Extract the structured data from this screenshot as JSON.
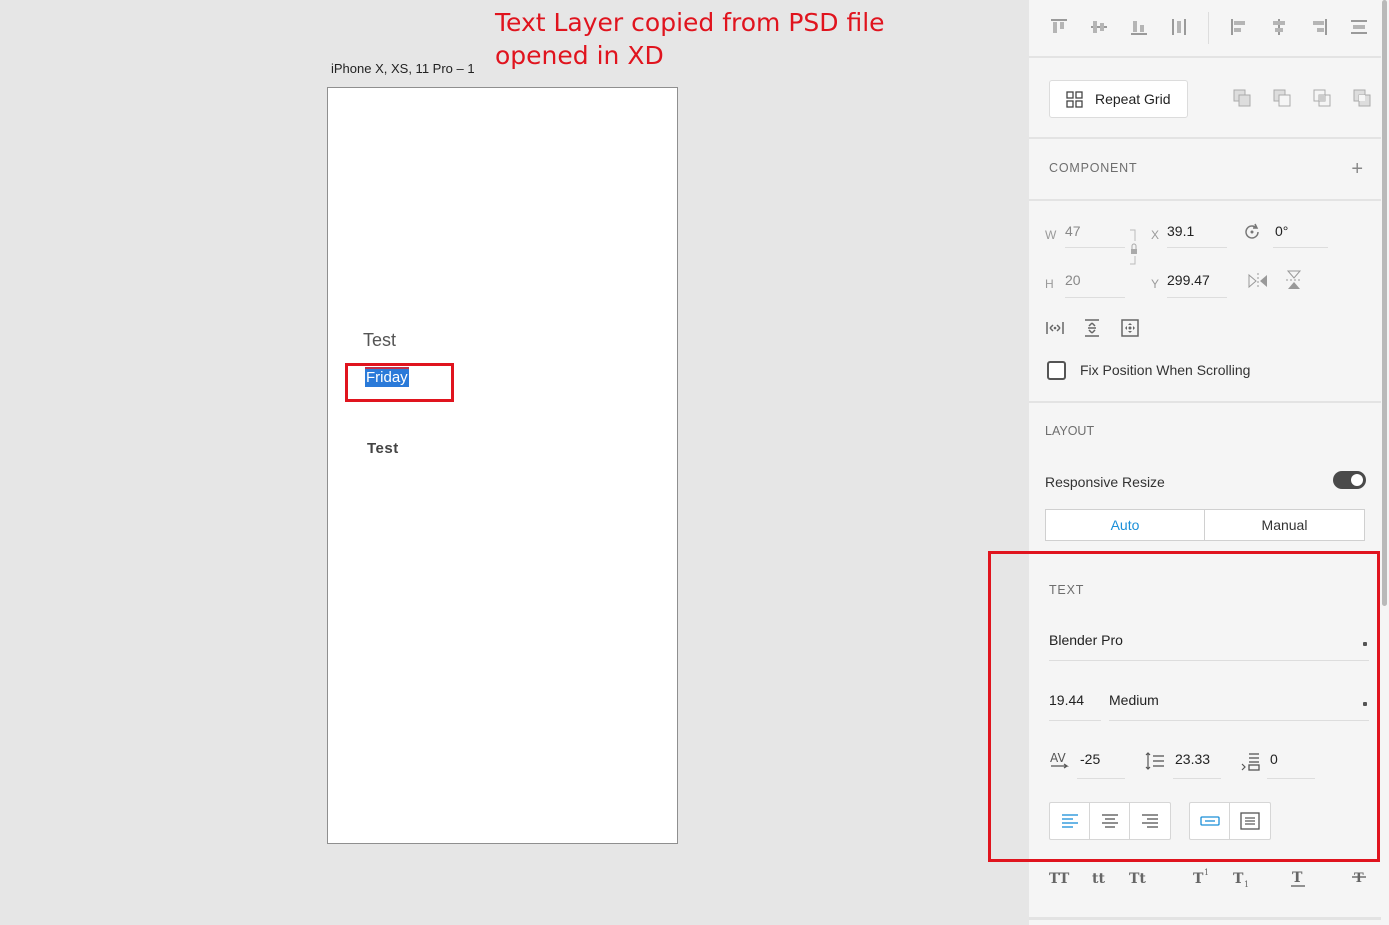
{
  "annotation": "Text Layer copied from PSD file opened in XD",
  "artboard": {
    "label": "iPhone X, XS, 11 Pro – 1",
    "texts": [
      "Test",
      "Friday",
      "Test"
    ]
  },
  "panel": {
    "repeat_grid_label": "Repeat Grid",
    "component": {
      "heading": "COMPONENT",
      "add_symbol": "+"
    },
    "transform": {
      "w_label": "W",
      "w_value": "47",
      "h_label": "H",
      "h_value": "20",
      "x_label": "X",
      "x_value": "39.1",
      "y_label": "Y",
      "y_value": "299.47",
      "rotation_value": "0°",
      "fix_position_label": "Fix Position When Scrolling"
    },
    "layout": {
      "heading": "LAYOUT",
      "responsive_resize_label": "Responsive Resize",
      "responsive_resize_on": true,
      "auto_label": "Auto",
      "manual_label": "Manual"
    },
    "text": {
      "heading": "TEXT",
      "font_family": "Blender Pro",
      "font_size": "19.44",
      "font_weight": "Medium",
      "character_spacing": "-25",
      "line_spacing": "23.33",
      "paragraph_spacing": "0"
    },
    "typography_buttons": [
      "TT",
      "tt",
      "Tt"
    ]
  },
  "colors": {
    "annotation_red": "#e0141e",
    "selection_blue": "#2a7ad9",
    "accent_blue": "#1a8fd8"
  }
}
